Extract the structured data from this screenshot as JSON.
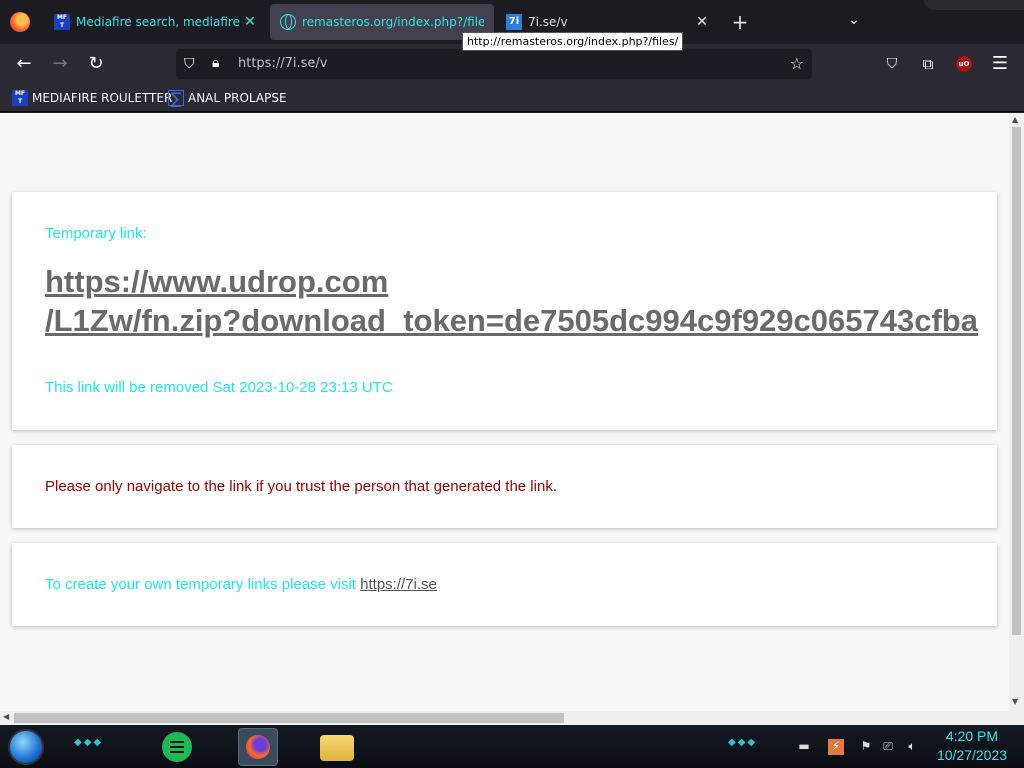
{
  "tabs": [
    {
      "title": "Mediafire search, mediafire search engine",
      "favicon": "mft-favicon"
    },
    {
      "title": "remasteros.org/index.php?/files/",
      "favicon": "globe-favicon"
    },
    {
      "title": "7i.se/v",
      "favicon": "7i-favicon"
    }
  ],
  "tooltip": "http://remasteros.org/index.php?/files/",
  "urlbar": {
    "url": "https://7i.se/v"
  },
  "bookmarks": [
    {
      "label": "MEDIAFIRE ROULETTER"
    },
    {
      "label": "ANAL PROLAPSE"
    }
  ],
  "page": {
    "temp_label": "Temporary link:",
    "link_line1": "https://www.udrop.com",
    "link_line2": "/L1Zw/fn.zip?download_token=de7505dc994c9f929c065743cfba",
    "removed_text": "This link will be removed Sat 2023-10-28 23:13 UTC",
    "warning_text": "Please only navigate to the link if you trust the person that generated the link.",
    "create_text": "To create your own temporary links please visit ",
    "create_link": "https://7i.se"
  },
  "taskbar": {
    "time": "4:20 PM",
    "date": "10/27/2023"
  },
  "colors": {
    "accent_cyan": "#1de8f0",
    "warning_red": "#9b0000",
    "link_gray": "#6a6a6a"
  }
}
